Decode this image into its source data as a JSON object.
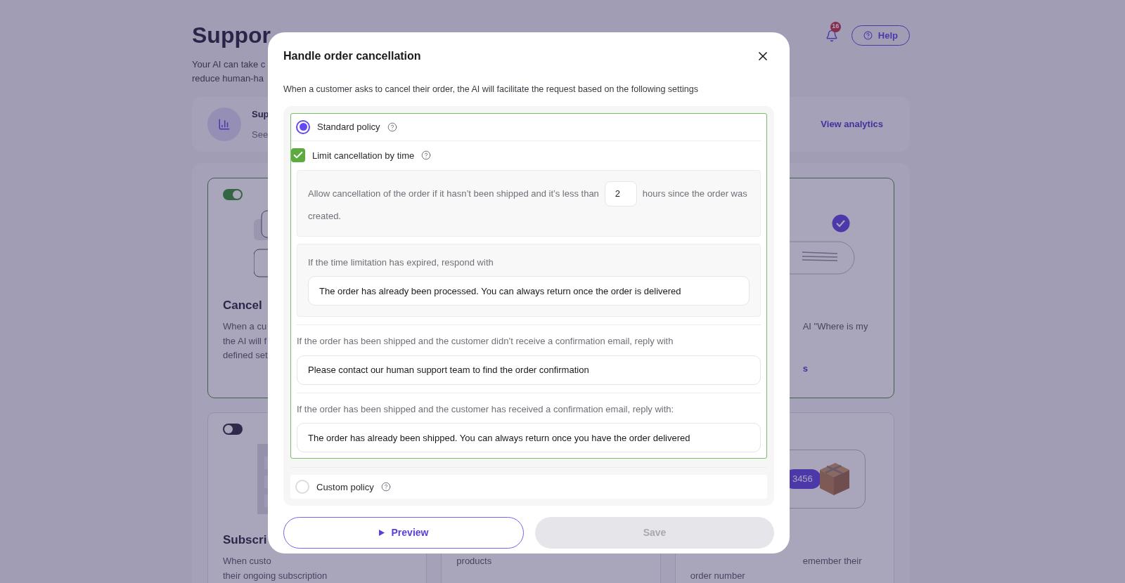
{
  "page": {
    "title": "Suppor",
    "subtitle_lines": [
      "Your AI can take c",
      "reduce human-ha"
    ],
    "notification_count": "16",
    "help_button": "Help"
  },
  "analytics_card": {
    "title": "Sup",
    "subtitle": "See",
    "link": "View analytics"
  },
  "skill_rows": [
    [
      {
        "enabled": true,
        "kind": "messages",
        "title": "Cancel",
        "description": [
          {
            "text": "When a cu"
          },
          {
            "text": "the AI will f"
          },
          {
            "text": "defined set"
          }
        ]
      },
      null,
      {
        "active": true,
        "kind": "check",
        "description": [
          {
            "text": "AI \"Where is my",
            "kind": "partial"
          }
        ],
        "link": {
          "text": "s",
          "kind": "partial"
        }
      }
    ],
    [
      {
        "enabled": false,
        "kind": "shelf",
        "title": "Subscri",
        "description": [
          {
            "text": "When custo"
          },
          {
            "text": "their ongoing subscription"
          }
        ]
      },
      {
        "description": [
          {
            "text": "products"
          }
        ]
      },
      {
        "kind": "parcel",
        "badge": "3456",
        "description": [
          {
            "text": "emember their",
            "kind": "partial"
          },
          {
            "text": "order number"
          }
        ]
      }
    ]
  ],
  "dialog": {
    "title": "Handle order cancellation",
    "description": "When a customer asks to cancel their order, the AI will facilitate the request based on the following settings",
    "policies": [
      {
        "label": "Standard policy",
        "selected": true
      },
      {
        "label": "Custom policy",
        "selected": false
      }
    ],
    "time_limit": {
      "label": "Limit cancellation by time",
      "checked": true,
      "text_before": "Allow cancellation of the order if it hasn’t been shipped and it’s less than",
      "hours": "2",
      "text_after": [
        "hours since the order was",
        "created."
      ]
    },
    "responses": [
      {
        "kind": "nested",
        "label": "If the time limitation has expired, respond with",
        "value": "The order has already been processed. You can always return once the order is delivered"
      },
      {
        "kind": "plain",
        "label": "If the order has been shipped and the customer didn’t receive a confirmation email, reply with",
        "value": "Please contact our human support team to find the order confirmation"
      },
      {
        "kind": "plain",
        "label": "If the order has been shipped and the customer has received a confirmation email, reply with:",
        "value": "The order has already been shipped. You can always return once you have the order delivered"
      }
    ],
    "preview_button": "Preview",
    "save_button": {
      "label": "Save",
      "disabled": true
    }
  }
}
